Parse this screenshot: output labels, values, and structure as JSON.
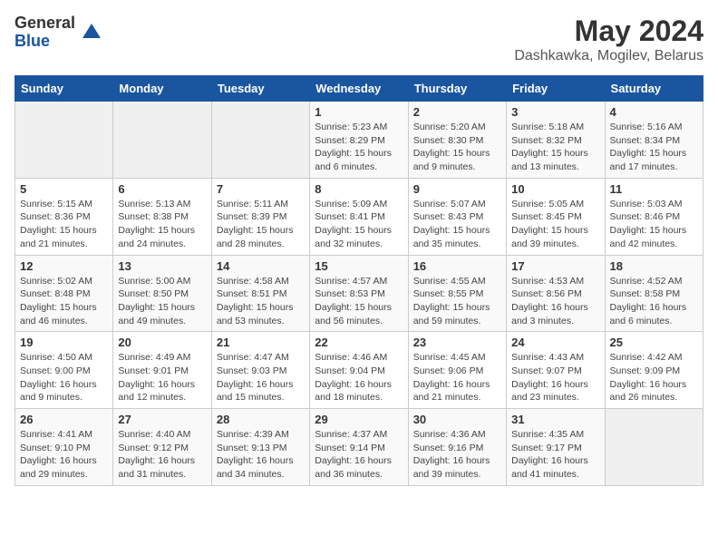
{
  "header": {
    "logo_general": "General",
    "logo_blue": "Blue",
    "month_title": "May 2024",
    "location": "Dashkawka, Mogilev, Belarus"
  },
  "days_of_week": [
    "Sunday",
    "Monday",
    "Tuesday",
    "Wednesday",
    "Thursday",
    "Friday",
    "Saturday"
  ],
  "weeks": [
    [
      {
        "day": "",
        "info": ""
      },
      {
        "day": "",
        "info": ""
      },
      {
        "day": "",
        "info": ""
      },
      {
        "day": "1",
        "info": "Sunrise: 5:23 AM\nSunset: 8:29 PM\nDaylight: 15 hours\nand 6 minutes."
      },
      {
        "day": "2",
        "info": "Sunrise: 5:20 AM\nSunset: 8:30 PM\nDaylight: 15 hours\nand 9 minutes."
      },
      {
        "day": "3",
        "info": "Sunrise: 5:18 AM\nSunset: 8:32 PM\nDaylight: 15 hours\nand 13 minutes."
      },
      {
        "day": "4",
        "info": "Sunrise: 5:16 AM\nSunset: 8:34 PM\nDaylight: 15 hours\nand 17 minutes."
      }
    ],
    [
      {
        "day": "5",
        "info": "Sunrise: 5:15 AM\nSunset: 8:36 PM\nDaylight: 15 hours\nand 21 minutes."
      },
      {
        "day": "6",
        "info": "Sunrise: 5:13 AM\nSunset: 8:38 PM\nDaylight: 15 hours\nand 24 minutes."
      },
      {
        "day": "7",
        "info": "Sunrise: 5:11 AM\nSunset: 8:39 PM\nDaylight: 15 hours\nand 28 minutes."
      },
      {
        "day": "8",
        "info": "Sunrise: 5:09 AM\nSunset: 8:41 PM\nDaylight: 15 hours\nand 32 minutes."
      },
      {
        "day": "9",
        "info": "Sunrise: 5:07 AM\nSunset: 8:43 PM\nDaylight: 15 hours\nand 35 minutes."
      },
      {
        "day": "10",
        "info": "Sunrise: 5:05 AM\nSunset: 8:45 PM\nDaylight: 15 hours\nand 39 minutes."
      },
      {
        "day": "11",
        "info": "Sunrise: 5:03 AM\nSunset: 8:46 PM\nDaylight: 15 hours\nand 42 minutes."
      }
    ],
    [
      {
        "day": "12",
        "info": "Sunrise: 5:02 AM\nSunset: 8:48 PM\nDaylight: 15 hours\nand 46 minutes."
      },
      {
        "day": "13",
        "info": "Sunrise: 5:00 AM\nSunset: 8:50 PM\nDaylight: 15 hours\nand 49 minutes."
      },
      {
        "day": "14",
        "info": "Sunrise: 4:58 AM\nSunset: 8:51 PM\nDaylight: 15 hours\nand 53 minutes."
      },
      {
        "day": "15",
        "info": "Sunrise: 4:57 AM\nSunset: 8:53 PM\nDaylight: 15 hours\nand 56 minutes."
      },
      {
        "day": "16",
        "info": "Sunrise: 4:55 AM\nSunset: 8:55 PM\nDaylight: 15 hours\nand 59 minutes."
      },
      {
        "day": "17",
        "info": "Sunrise: 4:53 AM\nSunset: 8:56 PM\nDaylight: 16 hours\nand 3 minutes."
      },
      {
        "day": "18",
        "info": "Sunrise: 4:52 AM\nSunset: 8:58 PM\nDaylight: 16 hours\nand 6 minutes."
      }
    ],
    [
      {
        "day": "19",
        "info": "Sunrise: 4:50 AM\nSunset: 9:00 PM\nDaylight: 16 hours\nand 9 minutes."
      },
      {
        "day": "20",
        "info": "Sunrise: 4:49 AM\nSunset: 9:01 PM\nDaylight: 16 hours\nand 12 minutes."
      },
      {
        "day": "21",
        "info": "Sunrise: 4:47 AM\nSunset: 9:03 PM\nDaylight: 16 hours\nand 15 minutes."
      },
      {
        "day": "22",
        "info": "Sunrise: 4:46 AM\nSunset: 9:04 PM\nDaylight: 16 hours\nand 18 minutes."
      },
      {
        "day": "23",
        "info": "Sunrise: 4:45 AM\nSunset: 9:06 PM\nDaylight: 16 hours\nand 21 minutes."
      },
      {
        "day": "24",
        "info": "Sunrise: 4:43 AM\nSunset: 9:07 PM\nDaylight: 16 hours\nand 23 minutes."
      },
      {
        "day": "25",
        "info": "Sunrise: 4:42 AM\nSunset: 9:09 PM\nDaylight: 16 hours\nand 26 minutes."
      }
    ],
    [
      {
        "day": "26",
        "info": "Sunrise: 4:41 AM\nSunset: 9:10 PM\nDaylight: 16 hours\nand 29 minutes."
      },
      {
        "day": "27",
        "info": "Sunrise: 4:40 AM\nSunset: 9:12 PM\nDaylight: 16 hours\nand 31 minutes."
      },
      {
        "day": "28",
        "info": "Sunrise: 4:39 AM\nSunset: 9:13 PM\nDaylight: 16 hours\nand 34 minutes."
      },
      {
        "day": "29",
        "info": "Sunrise: 4:37 AM\nSunset: 9:14 PM\nDaylight: 16 hours\nand 36 minutes."
      },
      {
        "day": "30",
        "info": "Sunrise: 4:36 AM\nSunset: 9:16 PM\nDaylight: 16 hours\nand 39 minutes."
      },
      {
        "day": "31",
        "info": "Sunrise: 4:35 AM\nSunset: 9:17 PM\nDaylight: 16 hours\nand 41 minutes."
      },
      {
        "day": "",
        "info": ""
      }
    ]
  ]
}
